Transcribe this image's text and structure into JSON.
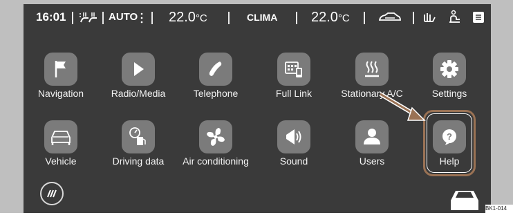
{
  "statusbar": {
    "time": "16:01",
    "auto_label": "AUTO",
    "left_temp": "22.0",
    "left_temp_unit": "°C",
    "clima_label": "CLIMA",
    "right_temp": "22.0",
    "right_temp_unit": "°C",
    "icons": [
      "seat-heating-icon",
      "fan-icon",
      "car-air-recirculation-icon",
      "seat-ventilation-icon",
      "heated-seat-icon",
      "menu-icon"
    ]
  },
  "apps": [
    {
      "label": "Navigation",
      "icon": "flag-icon"
    },
    {
      "label": "Radio/Media",
      "icon": "play-icon"
    },
    {
      "label": "Telephone",
      "icon": "phone-icon"
    },
    {
      "label": "Full Link",
      "icon": "full-link-icon"
    },
    {
      "label": "Stationary A/C",
      "icon": "heater-icon"
    },
    {
      "label": "Settings",
      "icon": "gear-icon"
    },
    {
      "label": "Vehicle",
      "icon": "car-icon"
    },
    {
      "label": "Driving data",
      "icon": "fuel-gauge-icon"
    },
    {
      "label": "Air conditioning",
      "icon": "fan-icon"
    },
    {
      "label": "Sound",
      "icon": "speaker-icon"
    },
    {
      "label": "Users",
      "icon": "user-icon"
    },
    {
      "label": "Help",
      "icon": "help-icon"
    }
  ],
  "figure_code": "BK1-014",
  "colors": {
    "screen_bg": "#3a3a3a",
    "icon_bg": "#7b7b7b",
    "highlight": "#9a7254",
    "text": "#ffffff"
  }
}
